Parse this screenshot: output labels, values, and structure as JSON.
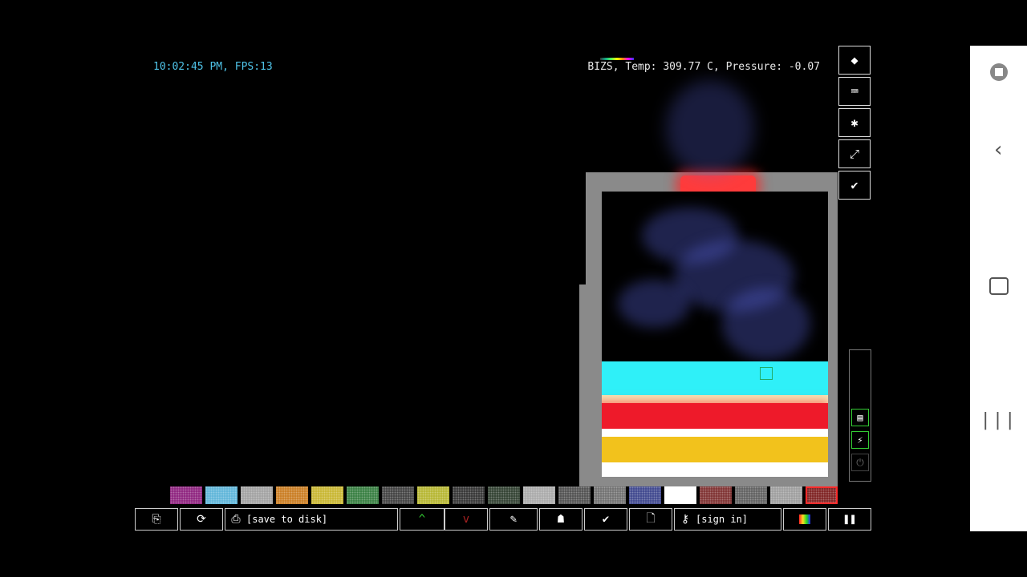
{
  "hud": {
    "left_text": "10:02:45 PM, FPS:13",
    "right_text": "BIZS, Temp: 309.77 C, Pressure: -0.07"
  },
  "tools": [
    {
      "name": "eraser-icon",
      "glyph": "◆"
    },
    {
      "name": "console-icon",
      "glyph": "⌨"
    },
    {
      "name": "settings-icon",
      "glyph": "✱"
    },
    {
      "name": "resize-icon",
      "glyph": "⤢"
    },
    {
      "name": "wrench-icon",
      "glyph": "✔"
    }
  ],
  "side_panel": {
    "buttons": [
      {
        "name": "wall-icon",
        "glyph": "▤"
      },
      {
        "name": "plug-icon",
        "glyph": "⚡"
      },
      {
        "name": "power-icon",
        "glyph": "⏻"
      }
    ]
  },
  "palette": [
    {
      "color": "#8a1b7a"
    },
    {
      "color": "#59b2d8"
    },
    {
      "color": "#9e9e9e"
    },
    {
      "color": "#c8781a"
    },
    {
      "color": "#c7b42a"
    },
    {
      "color": "#2f7a3a"
    },
    {
      "color": "#3a3a3a"
    },
    {
      "color": "#b4b42a"
    },
    {
      "color": "#2d2d2d"
    },
    {
      "color": "#2a3a2a"
    },
    {
      "color": "#a6a6a6"
    },
    {
      "color": "#4a4a4a"
    },
    {
      "color": "#6b6b6b"
    },
    {
      "color": "#38408a"
    },
    {
      "color": "#ffffff"
    },
    {
      "color": "#7a2a2a"
    },
    {
      "color": "#5a5a5a"
    },
    {
      "color": "#9a9a9a"
    },
    {
      "color": "#7a1a1a"
    }
  ],
  "toolbar": {
    "open_icon": "⎘",
    "reload_icon": "⟳",
    "save_label": "[save to disk]",
    "vote_up_icon": "^",
    "vote_down_icon": "v",
    "tags_icon": "✎",
    "report_icon": "☗",
    "check_icon": "✔",
    "new_icon": "🗋",
    "signin_label": "[sign in]",
    "pause_icon": "❚❚"
  },
  "colors": {
    "hud_left": "#4fc3e8",
    "accent_red": "#ff2b2b",
    "cyan_layer": "#2ff0f8",
    "gold_layer": "#f2c21c"
  }
}
